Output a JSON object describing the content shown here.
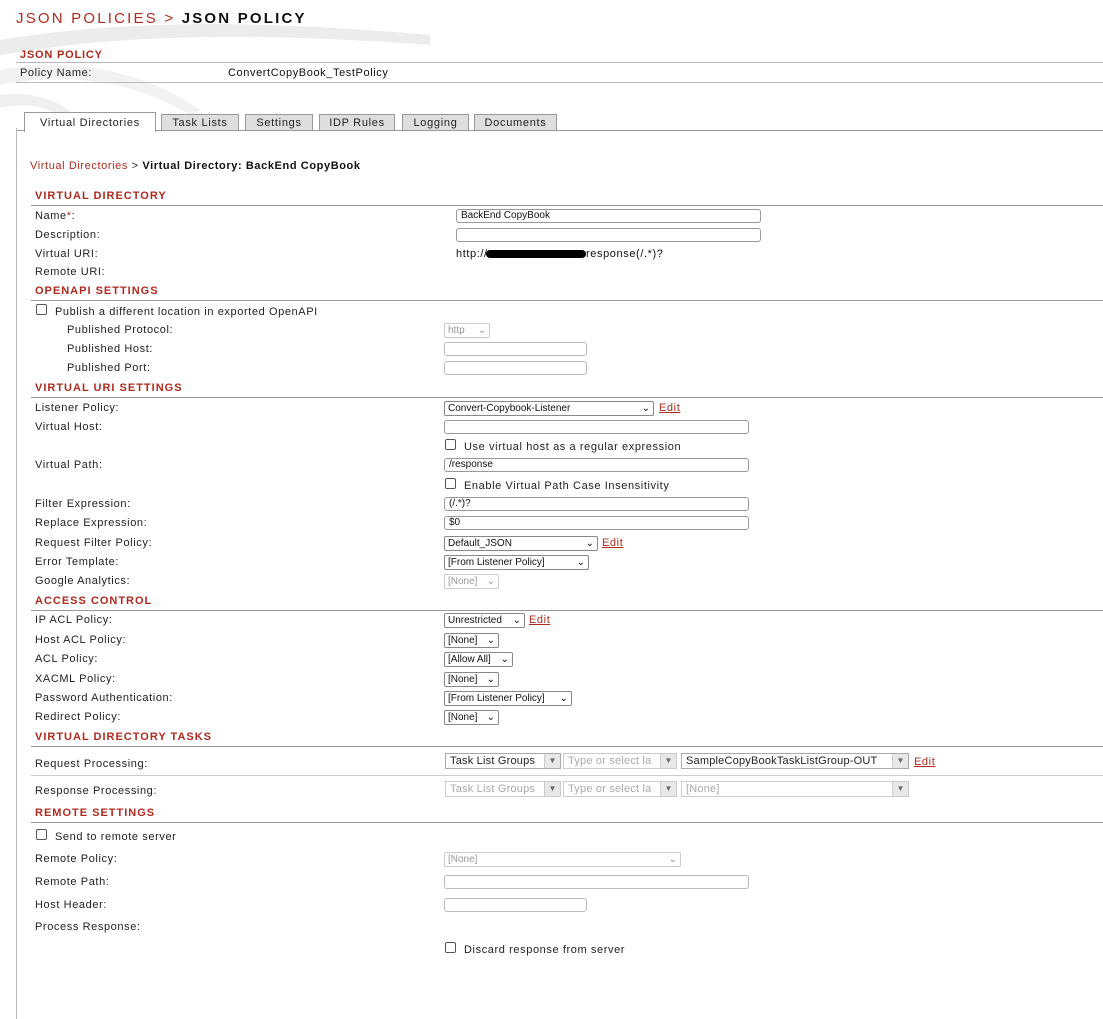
{
  "breadcrumb_top": {
    "parent": "JSON POLICIES",
    "separator": ">",
    "current": "JSON POLICY"
  },
  "policy_header": {
    "title": "JSON POLICY",
    "name_label": "Policy Name:",
    "name_value": "ConvertCopyBook_TestPolicy"
  },
  "tabs": [
    "Virtual Directories",
    "Task Lists",
    "Settings",
    "IDP Rules",
    "Logging",
    "Documents"
  ],
  "active_tab": "Virtual Directories",
  "breadcrumb": {
    "parent": "Virtual Directories",
    "separator": ">",
    "current": "Virtual Directory: BackEnd CopyBook"
  },
  "virtual_directory": {
    "title": "VIRTUAL DIRECTORY",
    "name_label": "Name",
    "required_mark": "*",
    "colon": ":",
    "name_value": "BackEnd CopyBook",
    "description_label": "Description:",
    "description_value": "",
    "virtual_uri_label": "Virtual URI:",
    "virtual_uri_prefix": "http://",
    "virtual_uri_suffix": "response(/.*)?",
    "remote_uri_label": "Remote URI:"
  },
  "openapi": {
    "title": "OPENAPI SETTINGS",
    "publish_label": "Publish a different location in exported OpenAPI",
    "publish_checked": false,
    "protocol_label": "Published Protocol:",
    "protocol_value": "http",
    "host_label": "Published Host:",
    "port_label": "Published Port:"
  },
  "virtual_uri_settings": {
    "title": "VIRTUAL URI SETTINGS",
    "listener_label": "Listener Policy:",
    "listener_value": "Convert-Copybook-Listener",
    "edit_label": "Edit",
    "virtual_host_label": "Virtual Host:",
    "virtual_host_value": "",
    "regex_label": "Use virtual host as a regular expression",
    "virtual_path_label": "Virtual Path:",
    "virtual_path_value": "/response",
    "case_label": "Enable Virtual Path Case Insensitivity",
    "filter_label": "Filter Expression:",
    "filter_value": "(/.*)?",
    "replace_label": "Replace Expression:",
    "replace_value": "$0",
    "request_filter_label": "Request Filter Policy:",
    "request_filter_value": "Default_JSON",
    "error_template_label": "Error Template:",
    "error_template_value": "[From Listener Policy]",
    "analytics_label": "Google Analytics:",
    "analytics_value": "[None]"
  },
  "access_control": {
    "title": "ACCESS CONTROL",
    "ip_acl_label": "IP ACL Policy:",
    "ip_acl_value": "Unrestricted",
    "edit_label": "Edit",
    "host_acl_label": "Host ACL Policy:",
    "host_acl_value": "[None]",
    "acl_label": "ACL Policy:",
    "acl_value": "[Allow All]",
    "xacml_label": "XACML Policy:",
    "xacml_value": "[None]",
    "password_label": "Password Authentication:",
    "password_value": "[From Listener Policy]",
    "redirect_label": "Redirect Policy:",
    "redirect_value": "[None]"
  },
  "tasks": {
    "title": "VIRTUAL DIRECTORY TASKS",
    "request_label": "Request Processing:",
    "response_label": "Response Processing:",
    "task_type": "Task List Groups",
    "type_placeholder": "Type or select la",
    "request_value": "SampleCopyBookTaskListGroup-OUT",
    "response_value": "[None]",
    "edit_label": "Edit"
  },
  "remote": {
    "title": "REMOTE SETTINGS",
    "send_label": "Send to remote server",
    "remote_policy_label": "Remote Policy:",
    "remote_policy_value": "[None]",
    "remote_path_label": "Remote Path:",
    "host_header_label": "Host Header:",
    "process_response_label": "Process Response:",
    "discard_label": "Discard response from server"
  }
}
